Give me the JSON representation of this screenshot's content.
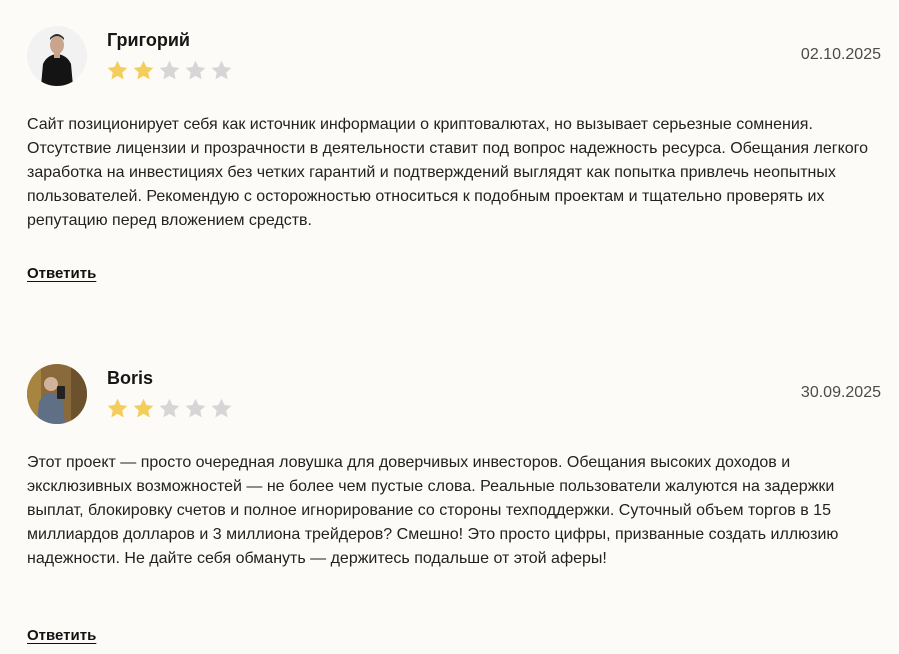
{
  "reviews": [
    {
      "author": "Григорий",
      "date": "02.10.2025",
      "rating": 2,
      "max_rating": 5,
      "text": "Сайт позиционирует себя как источник информации о криптовалютах, но вызывает серьезные сомнения. Отсутствие лицензии и прозрачности в деятельности ставит под вопрос надежность ресурса. Обещания легкого заработка на инвестициях без четких гарантий и подтверждений выглядят как попытка привлечь неопытных пользователей. Рекомендую с осторожностью относиться к подобным проектам и тщательно проверять их репутацию перед вложением средств.",
      "reply_label": "Ответить"
    },
    {
      "author": "Boris",
      "date": "30.09.2025",
      "rating": 2,
      "max_rating": 5,
      "text": "Этот проект — просто очередная ловушка для доверчивых инвесторов. Обещания высоких доходов и эксклюзивных возможностей — не более чем пустые слова. Реальные пользователи жалуются на задержки выплат, блокировку счетов и полное игнорирование со стороны техподдержки. Суточный объем торгов в 15 миллиардов долларов и 3 миллиона трейдеров? Смешно! Это просто цифры, призванные создать иллюзию надежности. Не дайте себя обмануть — держитесь подальше от этой аферы!",
      "reply_label": "Ответить"
    }
  ],
  "colors": {
    "star_filled": "#f5cd5a",
    "star_empty": "#d6d6d6",
    "background": "#fdfbf8"
  }
}
